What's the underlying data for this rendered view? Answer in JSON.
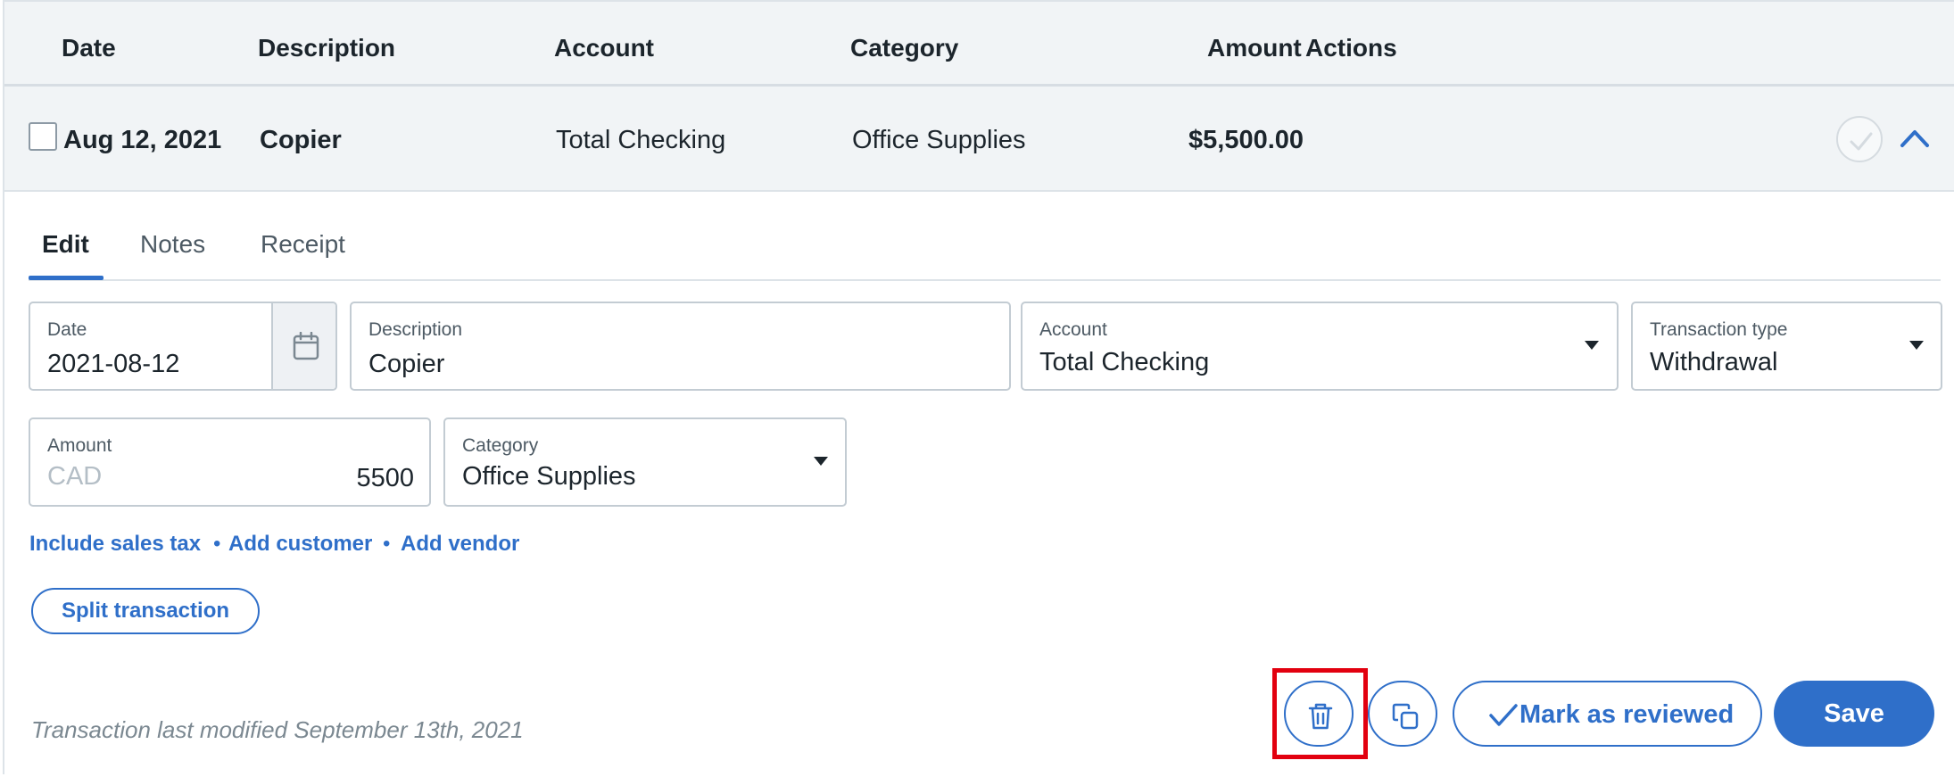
{
  "columns": {
    "date": "Date",
    "description": "Description",
    "account": "Account",
    "category": "Category",
    "amount": "Amount",
    "actions": "Actions"
  },
  "transaction": {
    "date": "Aug 12, 2021",
    "description": "Copier",
    "account": "Total Checking",
    "category": "Office Supplies",
    "amount": "$5,500.00"
  },
  "tabs": [
    "Edit",
    "Notes",
    "Receipt"
  ],
  "form": {
    "date_label": "Date",
    "date_value": "2021-08-12",
    "description_label": "Description",
    "description_value": "Copier",
    "account_label": "Account",
    "account_value": "Total Checking",
    "type_label": "Transaction type",
    "type_value": "Withdrawal",
    "amount_label": "Amount",
    "currency": "CAD",
    "amount_value": "5500",
    "category_label": "Category",
    "category_value": "Office Supplies"
  },
  "links": {
    "sales_tax": "Include sales tax",
    "customer": "Add customer",
    "vendor": "Add vendor",
    "separator": "•"
  },
  "buttons": {
    "split": "Split transaction",
    "mark_reviewed": "Mark as reviewed",
    "save": "Save"
  },
  "footer": {
    "modified": "Transaction last modified September 13th, 2021"
  },
  "colors": {
    "accent": "#2f6fc9",
    "highlight": "#e2000f"
  },
  "icons": {
    "calendar": "calendar-icon",
    "delete": "trash-icon",
    "duplicate": "copy-icon",
    "reviewed": "checkmark-icon",
    "collapse": "chevron-up-icon"
  }
}
